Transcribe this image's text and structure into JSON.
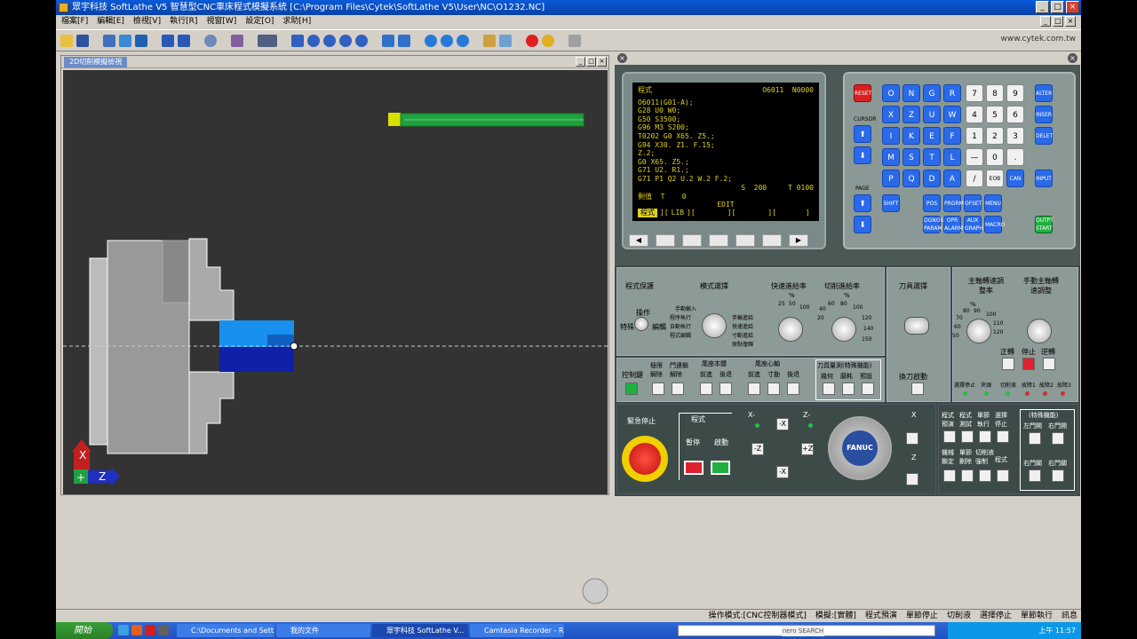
{
  "window": {
    "title": "眾宇科技 SoftLathe V5 智慧型CNC車床程式模擬系統 [C:\\Program Files\\Cytek\\SoftLathe V5\\User\\NC\\O1232.NC]"
  },
  "menu": [
    "檔案[F]",
    "編輯[E]",
    "檢視[V]",
    "執行[R]",
    "視窗[W]",
    "設定[O]",
    "求助[H]"
  ],
  "toolbar_url": "www.cytek.com.tw",
  "sim": {
    "tab": "2D切削模擬檢視",
    "axis_x": "X",
    "axis_z": "Z"
  },
  "crt": {
    "header_left": "程式",
    "header_right": "O6011  N0000",
    "lines": [
      "O6011(G01-A);",
      "G28 U0 W0;",
      "G50 S3500;",
      "G96 M3 S200;",
      "T0202 G0 X65. Z5.;",
      "G94 X30. Z1. F.15;",
      "Z.2;",
      "G0 X65. Z5.;",
      "G71 U2. R1.;",
      "G71 P1 Q2 U.2 W.2 F.2;"
    ],
    "status_s": "S  200",
    "status_t": "T 0100",
    "status_left": "剩值  T    0",
    "mode": "EDIT",
    "softkeys": [
      "程式",
      "LIB",
      "",
      "",
      ""
    ]
  },
  "keypad": {
    "reset": "RESET",
    "cursor": "CURSOR",
    "page": "PAGE",
    "alpha": [
      "O",
      "N",
      "G",
      "R",
      "X",
      "Z",
      "U",
      "W",
      "I",
      "K",
      "E",
      "F",
      "M",
      "S",
      "T",
      "L",
      "P",
      "Q",
      "D",
      "A"
    ],
    "nums": [
      "7",
      "8",
      "9",
      "4",
      "5",
      "6",
      "1",
      "2",
      "3",
      "—",
      "0",
      "."
    ],
    "nums2": [
      "/",
      "EOB"
    ],
    "right": [
      "ALTER",
      "INSER",
      "DELET",
      "INPUT"
    ],
    "can": "CAN",
    "shift": "SHIFT",
    "func": [
      "POS",
      "PRGRM",
      "OFSET",
      "MENU",
      "DGNOS PARAM",
      "OPR ALARM",
      "AUX GRAPH",
      "MACRO"
    ],
    "output": "OUTPT START"
  },
  "panel": {
    "prog_protect": "程式保護",
    "mode_select": "模式選擇",
    "rapid_override": "快速進給率",
    "feed_override": "切削進給率",
    "tool_select": "刀具選擇",
    "spindle_override": "主軸轉速調整率",
    "manual_spindle": "手動主軸轉速調整",
    "op_label": "操作",
    "special": "特殊",
    "edit": "編輯",
    "modes": [
      "手動輸入",
      "程序執行",
      "自動執行",
      "程式編輯",
      "手輪進給",
      "快速進給",
      "寸動進給",
      "原點復歸"
    ],
    "pct": "%",
    "rapid_vals": [
      "25",
      "50",
      "100"
    ],
    "feed_vals": [
      "60",
      "80",
      "100",
      "120",
      "140",
      "150",
      "20",
      "40"
    ],
    "spin_vals": [
      "80",
      "90",
      "100",
      "110",
      "120",
      "50",
      "60",
      "70"
    ],
    "tool_change": "換刀啟動",
    "forward": "正轉",
    "stop": "停止",
    "reverse": "逆轉",
    "key_lock": "控制鍵",
    "limit_release": "極限\n解除",
    "door_release": "門連鎖\n解除",
    "tail_body": "尾座本體",
    "tail_center": "尾座心軸",
    "fwd": "前進",
    "back": "後退",
    "jog": "寸動",
    "tool_measure": "刀具量測(特殊機能)",
    "geometry": "幾何",
    "wear": "磨耗",
    "preset": "預設",
    "sel_stop": "選擇停止",
    "coolant": "夾頭",
    "cut_water": "切削液",
    "fault1": "故障1",
    "fault2": "故障2",
    "fault3": "故障3",
    "estop": "緊急停止",
    "program": "程式",
    "pause": "暫停",
    "start": "啟動",
    "xneg": "X-",
    "zneg": "Z-",
    "xpos": "X",
    "zpos": "Z",
    "mpg": "FANUC",
    "prog_preview": "程式預演",
    "prog_test": "程式測試",
    "single_block": "單節執行",
    "opt_stop": "選擇停止",
    "machine_lock": "機械鎖定",
    "block_delete": "單節刪除",
    "coolant_force": "切削液強制",
    "prog_restart": "程式",
    "special_func": "(特殊機能)",
    "left_door_open": "左門開",
    "right_door_open": "右門開",
    "left_door_close": "右門關",
    "right_door_close": "右門關"
  },
  "statusbar": [
    "操作模式:[CNC控制器模式]",
    "模擬:[實體]",
    "程式預演",
    "單節停止",
    "切削液",
    "選擇停止",
    "單節執行",
    "訊息"
  ],
  "taskbar": {
    "start": "開始",
    "tasks": [
      "C:\\Documents and Sett...",
      "我的文件",
      "眾宇科技 SoftLathe V...",
      "Camtasia Recorder - R..."
    ],
    "clock": "上午 11:57",
    "nero": "nero SEARCH"
  }
}
